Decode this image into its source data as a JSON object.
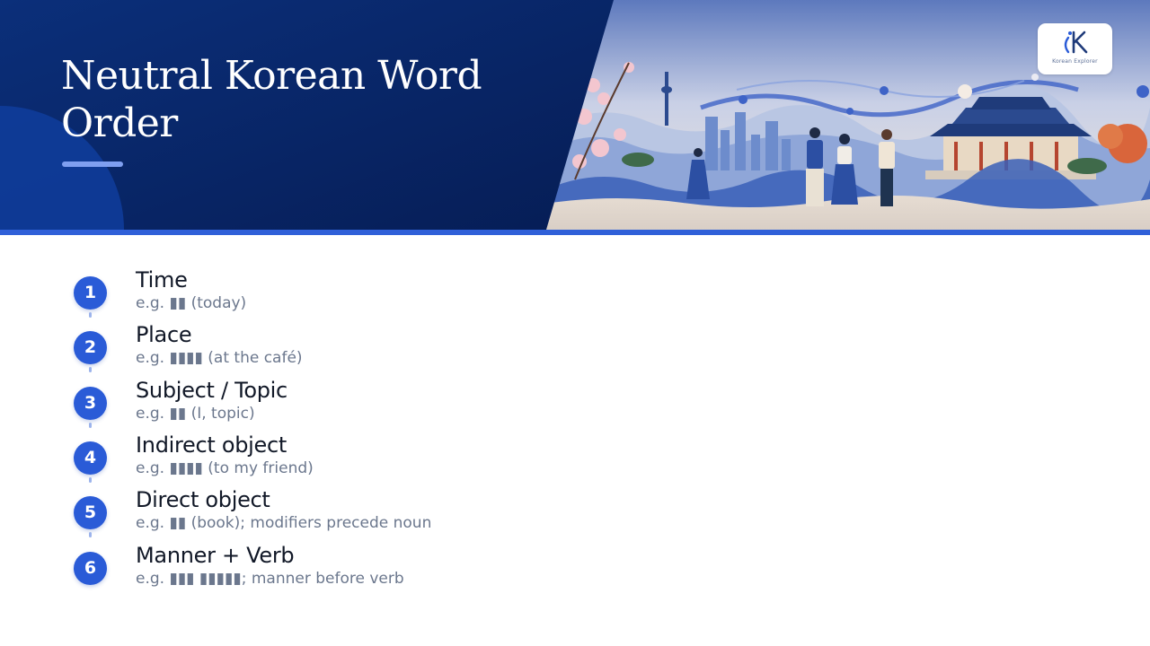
{
  "slide": {
    "title": "Neutral Korean Word Order",
    "logo": {
      "icon": "ik-logo-icon",
      "text": "Korean Explorer"
    },
    "colors": {
      "header_navy": "#0a2a6e",
      "accent_blue": "#2a5bd7",
      "bullet_bar": "#7f9ff0",
      "label_text": "#111827",
      "example_text": "#6b778d"
    },
    "steps": [
      {
        "number": "1",
        "label": "Time",
        "example": "e.g. ▮▮ (today)"
      },
      {
        "number": "2",
        "label": "Place",
        "example": "e.g. ▮▮▮▮ (at the café)"
      },
      {
        "number": "3",
        "label": "Subject / Topic",
        "example": "e.g. ▮▮ (I, topic)"
      },
      {
        "number": "4",
        "label": "Indirect object",
        "example": "e.g. ▮▮▮▮ (to my friend)"
      },
      {
        "number": "5",
        "label": "Direct object",
        "example": "e.g. ▮▮ (book); modifiers precede noun"
      },
      {
        "number": "6",
        "label": "Manner + Verb",
        "example": "e.g. ▮▮▮ ▮▮▮▮▮; manner before verb"
      }
    ]
  }
}
